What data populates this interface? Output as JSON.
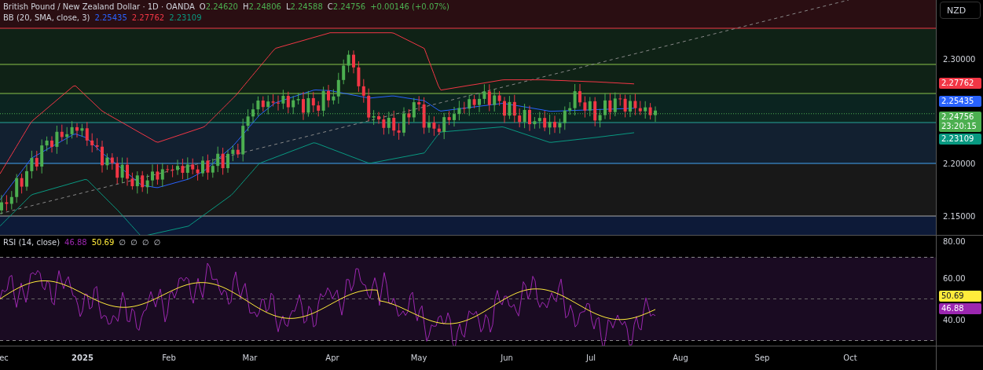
{
  "legend": {
    "title": "British Pound / New Zealand Dollar · 1D · OANDA",
    "ohlc": [
      {
        "label": "O",
        "value": "2.24620"
      },
      {
        "label": "H",
        "value": "2.24806"
      },
      {
        "label": "L",
        "value": "2.24588"
      },
      {
        "label": "C",
        "value": "2.24756"
      }
    ],
    "change": "+0.00146 (+0.07%)"
  },
  "bb_legend": {
    "title": "BB (20, SMA, close, 3)",
    "values": [
      {
        "value": "2.25435",
        "color": "#2962ff"
      },
      {
        "value": "2.27762",
        "color": "#f23645"
      },
      {
        "value": "2.23109",
        "color": "#089981"
      }
    ]
  },
  "price_axis": {
    "currency": "NZD",
    "ticks": [
      "2.30000",
      "2.20000",
      "2.15000"
    ],
    "badges": [
      {
        "value": "2.27762",
        "color": "#f23645"
      },
      {
        "value": "2.25435",
        "color": "#2962ff"
      },
      {
        "value": "2.24756",
        "sub": "23:20:15",
        "color": "#4caf50"
      },
      {
        "value": "2.23109",
        "color": "#089981"
      }
    ]
  },
  "rsi": {
    "title": "RSI (14, close)",
    "values": [
      {
        "value": "46.88",
        "color": "#9c27b0"
      },
      {
        "value": "50.69",
        "color": "#ffeb3b"
      }
    ],
    "extras": [
      "∅",
      "∅",
      "∅",
      "∅"
    ],
    "ticks": [
      "80.00",
      "60.00",
      "40.00"
    ],
    "badges": [
      {
        "value": "50.69",
        "color": "#ffeb3b"
      },
      {
        "value": "46.88",
        "color": "#9c27b0"
      }
    ]
  },
  "time_axis": {
    "labels": [
      {
        "text": "ec",
        "bold": false
      },
      {
        "text": "2025",
        "bold": true
      },
      {
        "text": "Feb",
        "bold": false
      },
      {
        "text": "Mar",
        "bold": false
      },
      {
        "text": "Apr",
        "bold": false
      },
      {
        "text": "May",
        "bold": false
      },
      {
        "text": "Jun",
        "bold": false
      },
      {
        "text": "Jul",
        "bold": false
      },
      {
        "text": "Aug",
        "bold": false
      },
      {
        "text": "Sep",
        "bold": false
      },
      {
        "text": "Oct",
        "bold": false
      }
    ]
  }
}
